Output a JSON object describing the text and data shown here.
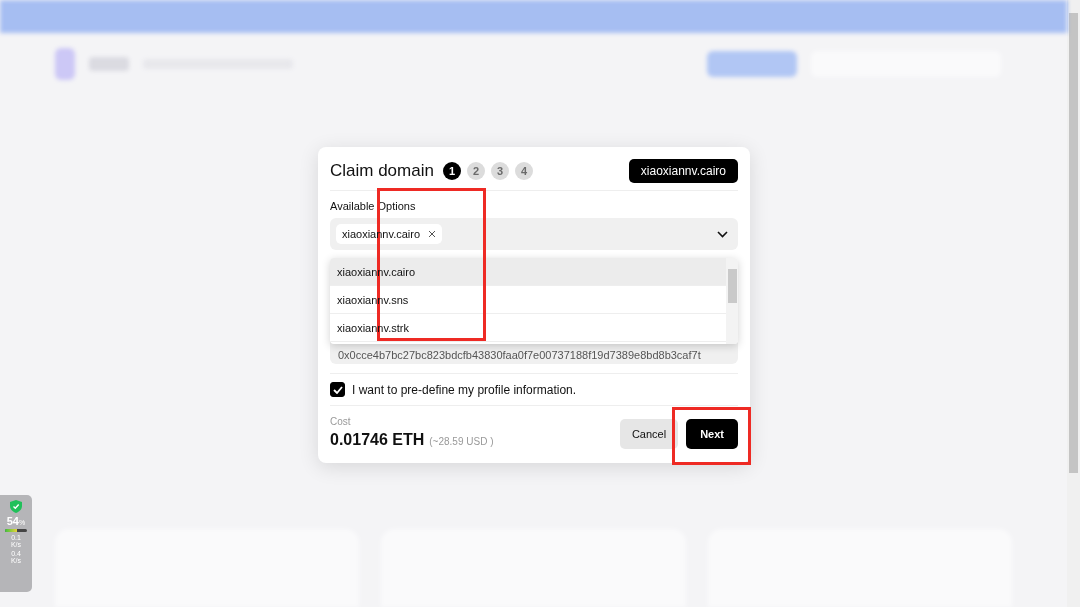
{
  "modal": {
    "title": "Claim domain",
    "steps": [
      {
        "label": "1",
        "selected": true
      },
      {
        "label": "2",
        "selected": false
      },
      {
        "label": "3",
        "selected": false
      },
      {
        "label": "4",
        "selected": false
      }
    ],
    "domain_badge": "xiaoxiannv.cairo",
    "select": {
      "label": "Available Options",
      "chips": [
        "xiaoxiannv.cairo"
      ],
      "options": [
        {
          "label": "xiaoxiannv.cairo",
          "selected": true
        },
        {
          "label": "xiaoxiannv.sns",
          "selected": false
        },
        {
          "label": "xiaoxiannv.strk",
          "selected": false
        }
      ]
    },
    "address_field": {
      "value": "0x0cce4b7bc27bc823bdcfb43830faa0f7e00737188f19d7389e8bd8b3caf7t"
    },
    "checkbox": {
      "label": "I want to pre-define my profile information.",
      "checked": true
    },
    "cost": {
      "label": "Cost",
      "amount": "0.01746 ETH",
      "usd": "(~28.59 USD )"
    },
    "buttons": [
      {
        "label": "Cancel",
        "kind": "secondary"
      },
      {
        "label": "Next",
        "kind": "primary"
      }
    ]
  },
  "system_monitor": {
    "percent": "54",
    "percent_unit": "%",
    "level": 0.54,
    "upload": "0.1",
    "upload_unit": "K/s",
    "download": "0.4",
    "download_unit": "K/s"
  }
}
